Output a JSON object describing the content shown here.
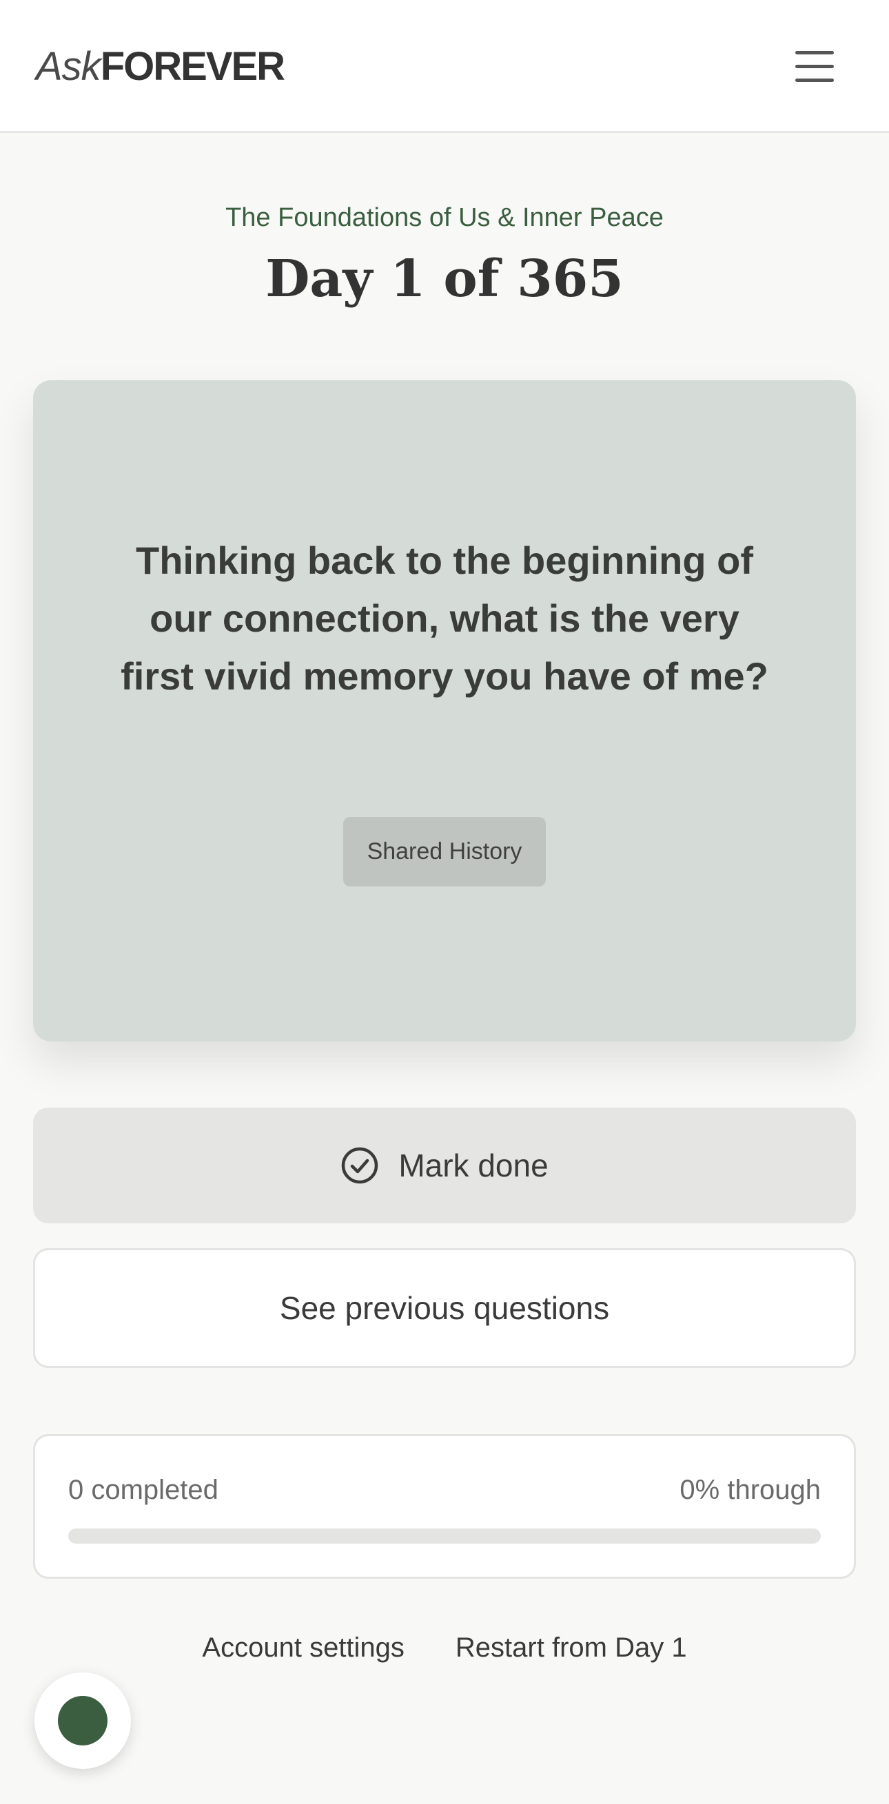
{
  "header": {
    "logo_ask": "Ask",
    "logo_forever": "FOREVER",
    "menu_icon": "hamburger-menu-icon"
  },
  "main": {
    "eyebrow": "The Foundations of Us & Inner Peace",
    "day_title": "Day 1 of 365"
  },
  "question_card": {
    "question": "Thinking back to the beginning of our connection, what is the very first vivid memory you have of me?",
    "tag": "Shared History"
  },
  "actions": {
    "mark_done_label": "Mark done",
    "mark_done_icon": "check-circle-icon",
    "previous_label": "See previous questions"
  },
  "progress": {
    "completed_label": "0 completed",
    "percent_label": "0% through",
    "percent_value": 0
  },
  "footer": {
    "account_settings": "Account settings",
    "restart": "Restart from Day 1"
  },
  "colors": {
    "accent": "#3b5e40",
    "card_bg": "#d5dcd7",
    "page_bg": "#f8f8f7"
  }
}
